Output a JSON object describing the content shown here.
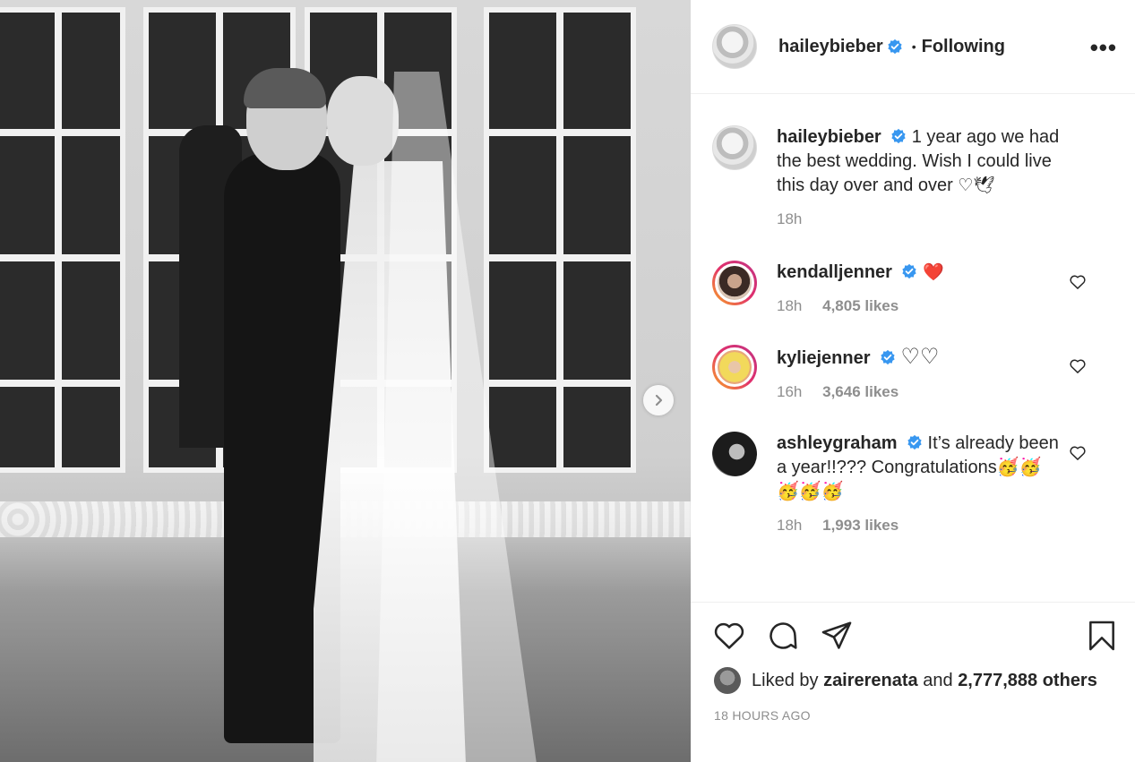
{
  "post": {
    "author": "haileybieber",
    "follow_dot": "•",
    "follow_status": "Following",
    "more_label": "•••"
  },
  "caption": {
    "username": "haileybieber",
    "text": "1 year ago we had the best wedding. Wish I could live this day over and over ",
    "emoji": "♡🕊",
    "time": "18h"
  },
  "comments": [
    {
      "username": "kendalljenner",
      "text": "❤️",
      "time": "18h",
      "likes": "4,805 likes"
    },
    {
      "username": "kyliejenner",
      "text": "♡♡",
      "time": "16h",
      "likes": "3,646 likes"
    },
    {
      "username": "ashleygraham",
      "text": "It’s already been a year!!??? Congratulations🥳🥳🥳🥳🥳",
      "time": "18h",
      "likes": "1,993 likes"
    }
  ],
  "likes": {
    "prefix": "Liked by",
    "user": "zairerenata",
    "middle": "and",
    "count": "2,777,888 others"
  },
  "timestamp": "18 HOURS AGO",
  "colors": {
    "verified": "#3897f0",
    "text": "#262626",
    "muted": "#8e8e8e",
    "heart_red": "#ed4956"
  },
  "icons": [
    "verified-badge-icon",
    "more-options-icon",
    "heart-icon",
    "comment-icon",
    "share-icon",
    "bookmark-icon",
    "chevron-right-icon"
  ]
}
